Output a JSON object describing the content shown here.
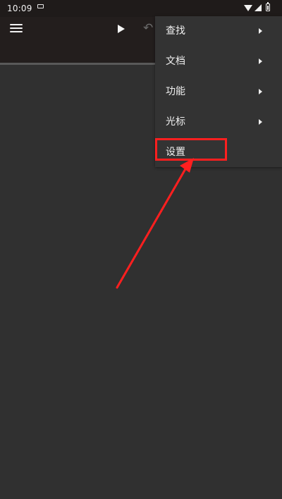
{
  "status_bar": {
    "time": "10:09",
    "left_icon": "notification-icon",
    "icons": [
      "wifi-icon",
      "signal-icon",
      "battery-icon"
    ]
  },
  "toolbar": {
    "menu_icon": "menu-icon",
    "play_icon": "play-icon",
    "undo_icon": "undo-icon",
    "undo_symbol": "↶"
  },
  "menu": {
    "items": [
      {
        "label": "查找",
        "has_submenu": true
      },
      {
        "label": "文档",
        "has_submenu": true
      },
      {
        "label": "功能",
        "has_submenu": true
      },
      {
        "label": "光标",
        "has_submenu": true
      },
      {
        "label": "设置",
        "has_submenu": false
      }
    ]
  },
  "annotation": {
    "highlight_color": "#ff1f1f",
    "target": "设置"
  },
  "colors": {
    "background": "#303030",
    "toolbar": "#231e1d",
    "menu_background": "#333333",
    "accent": "#ff1f1f"
  }
}
